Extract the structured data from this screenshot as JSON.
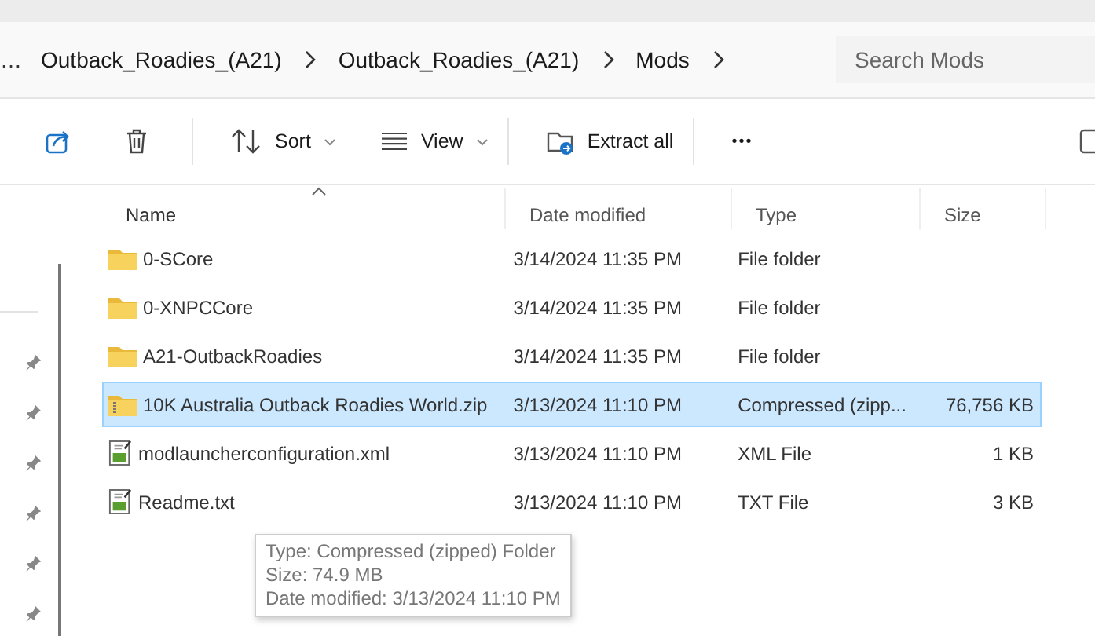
{
  "address_bar": {
    "overflow": "…",
    "crumbs": [
      "Outback_Roadies_(A21)",
      "Outback_Roadies_(A21)",
      "Mods"
    ]
  },
  "search": {
    "placeholder": "Search Mods"
  },
  "toolbar": {
    "sort": "Sort",
    "view": "View",
    "extract": "Extract all",
    "more": "•••"
  },
  "columns": [
    {
      "label": "Name",
      "sorted": true
    },
    {
      "label": "Date modified",
      "sorted": false
    },
    {
      "label": "Type",
      "sorted": false
    },
    {
      "label": "Size",
      "sorted": false
    }
  ],
  "rows": [
    {
      "kind": "folder",
      "name": "0-SCore",
      "date": "3/14/2024 11:35 PM",
      "type": "File folder",
      "selected": false
    },
    {
      "kind": "folder",
      "name": "0-XNPCCore",
      "date": "3/14/2024 11:35 PM",
      "type": "File folder",
      "selected": false
    },
    {
      "kind": "folder",
      "name": "A21-OutbackRoadies",
      "date": "3/14/2024 11:35 PM",
      "type": "File folder",
      "selected": false
    },
    {
      "kind": "zip",
      "name": "10K Australia Outback Roadies World.zip",
      "date": "3/13/2024 11:10 PM",
      "type": "Compressed (zipp...",
      "size": "76,756 KB",
      "selected": true
    },
    {
      "kind": "file",
      "name": "modlauncherconfiguration.xml",
      "date": "3/13/2024 11:10 PM",
      "type": "XML File",
      "size": "1 KB",
      "selected": false
    },
    {
      "kind": "file",
      "name": "Readme.txt",
      "date": "3/13/2024 11:10 PM",
      "type": "TXT File",
      "size": "3 KB",
      "selected": false
    }
  ],
  "tooltip": {
    "lines": [
      "Type: Compressed (zipped) Folder",
      "Size: 74.9 MB",
      "Date modified: 3/13/2024 11:10 PM"
    ]
  }
}
